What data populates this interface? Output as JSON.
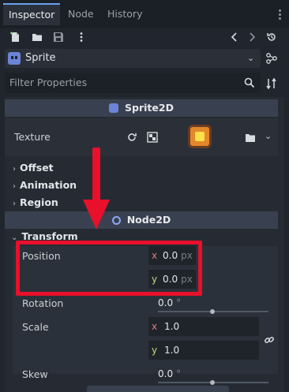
{
  "tabs": [
    {
      "label": "Inspector",
      "active": true
    },
    {
      "label": "Node",
      "active": false
    },
    {
      "label": "History",
      "active": false
    }
  ],
  "toolbar": {
    "icons": [
      "new-resource-icon",
      "open-folder-icon",
      "save-icon",
      "more-icon",
      "back-icon",
      "forward-icon",
      "history-icon"
    ]
  },
  "object": {
    "name": "Sprite",
    "icon": "sprite2d-icon"
  },
  "filter": {
    "placeholder": "Filter Properties"
  },
  "sections": {
    "sprite2d": "Sprite2D",
    "node2d": "Node2D"
  },
  "sprite2d_props": {
    "texture_label": "Texture",
    "offset": "Offset",
    "animation": "Animation",
    "region": "Region"
  },
  "transform": {
    "title": "Transform",
    "position_label": "Position",
    "position_x": "0.0",
    "position_y": "0.0",
    "position_unit": "px",
    "rotation_label": "Rotation",
    "rotation_value": "0.0",
    "rotation_unit": "°",
    "scale_label": "Scale",
    "scale_x": "1.0",
    "scale_y": "1.0",
    "skew_label": "Skew",
    "skew_value": "0.0",
    "skew_unit": "°",
    "x_axis": "x",
    "y_axis": "y"
  },
  "colors": {
    "accent": "#6aa2ef",
    "highlight": "#e8102b",
    "axis_x": "#e07a7a",
    "axis_y": "#b7e07a"
  }
}
